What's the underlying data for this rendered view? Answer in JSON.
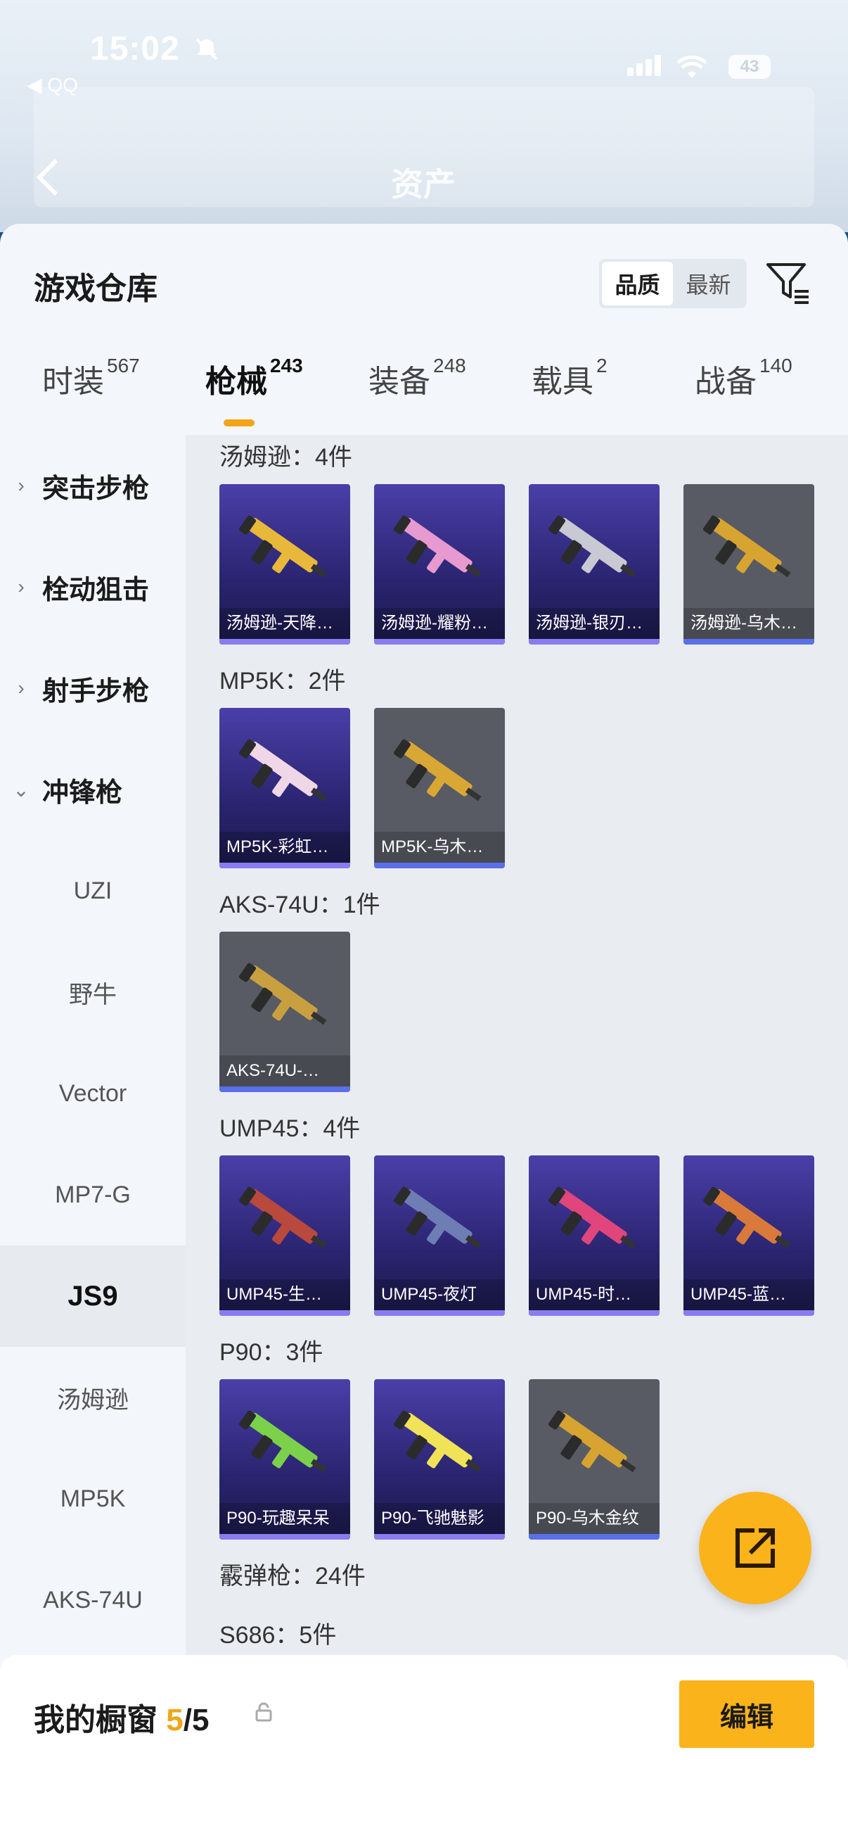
{
  "status": {
    "time": "15:02",
    "back_app": "◀ QQ",
    "battery": "43"
  },
  "nav": {
    "title": "资产"
  },
  "panel": {
    "title": "游戏仓库",
    "sort_options": [
      "品质",
      "最新"
    ],
    "active_sort": "品质"
  },
  "tabs": [
    {
      "label": "时装",
      "count": "567"
    },
    {
      "label": "枪械",
      "count": "243"
    },
    {
      "label": "装备",
      "count": "248"
    },
    {
      "label": "载具",
      "count": "2"
    },
    {
      "label": "战备",
      "count": "140"
    }
  ],
  "sidebar": {
    "categories": [
      "突击步枪",
      "栓动狙击",
      "射手步枪",
      "冲锋枪"
    ],
    "subitems": [
      "UZI",
      "野牛",
      "Vector",
      "MP7-G",
      "JS9",
      "汤姆逊",
      "MP5K",
      "AKS-74U"
    ],
    "active_sub": "JS9"
  },
  "groups": [
    {
      "title": "汤姆逊：4件",
      "items": [
        {
          "name": "汤姆逊-天降…",
          "quality": "purple",
          "color": "#e8b83a"
        },
        {
          "name": "汤姆逊-耀粉…",
          "quality": "purple",
          "color": "#e79ad0"
        },
        {
          "name": "汤姆逊-银刃…",
          "quality": "purple",
          "color": "#c9c9d4"
        },
        {
          "name": "汤姆逊-乌木…",
          "quality": "gray",
          "color": "#d7a431"
        }
      ]
    },
    {
      "title": "MP5K：2件",
      "items": [
        {
          "name": "MP5K-彩虹…",
          "quality": "purple",
          "color": "#f0d7e7"
        },
        {
          "name": "MP5K-乌木…",
          "quality": "gray",
          "color": "#d9a733"
        }
      ]
    },
    {
      "title": "AKS-74U：1件",
      "items": [
        {
          "name": "AKS-74U-…",
          "quality": "gray",
          "color": "#c9a040"
        }
      ]
    },
    {
      "title": "UMP45：4件",
      "items": [
        {
          "name": "UMP45-生…",
          "quality": "purple",
          "color": "#b9483d"
        },
        {
          "name": "UMP45-夜灯",
          "quality": "purple",
          "color": "#6e7db3"
        },
        {
          "name": "UMP45-时…",
          "quality": "purple",
          "color": "#e0457b"
        },
        {
          "name": "UMP45-蓝…",
          "quality": "purple",
          "color": "#d97a3a"
        }
      ]
    },
    {
      "title": "P90：3件",
      "items": [
        {
          "name": "P90-玩趣呆呆",
          "quality": "purple",
          "color": "#7bd24a"
        },
        {
          "name": "P90-飞驰魅影",
          "quality": "purple",
          "color": "#f1e357"
        },
        {
          "name": "P90-乌木金纹",
          "quality": "gray",
          "color": "#d7a431"
        }
      ]
    },
    {
      "title": "霰弹枪：24件",
      "items": []
    },
    {
      "title": "S686：5件",
      "items": []
    }
  ],
  "showcase": {
    "label": "我的橱窗",
    "current": "5",
    "sep_total": "/5",
    "edit_label": "编辑"
  }
}
